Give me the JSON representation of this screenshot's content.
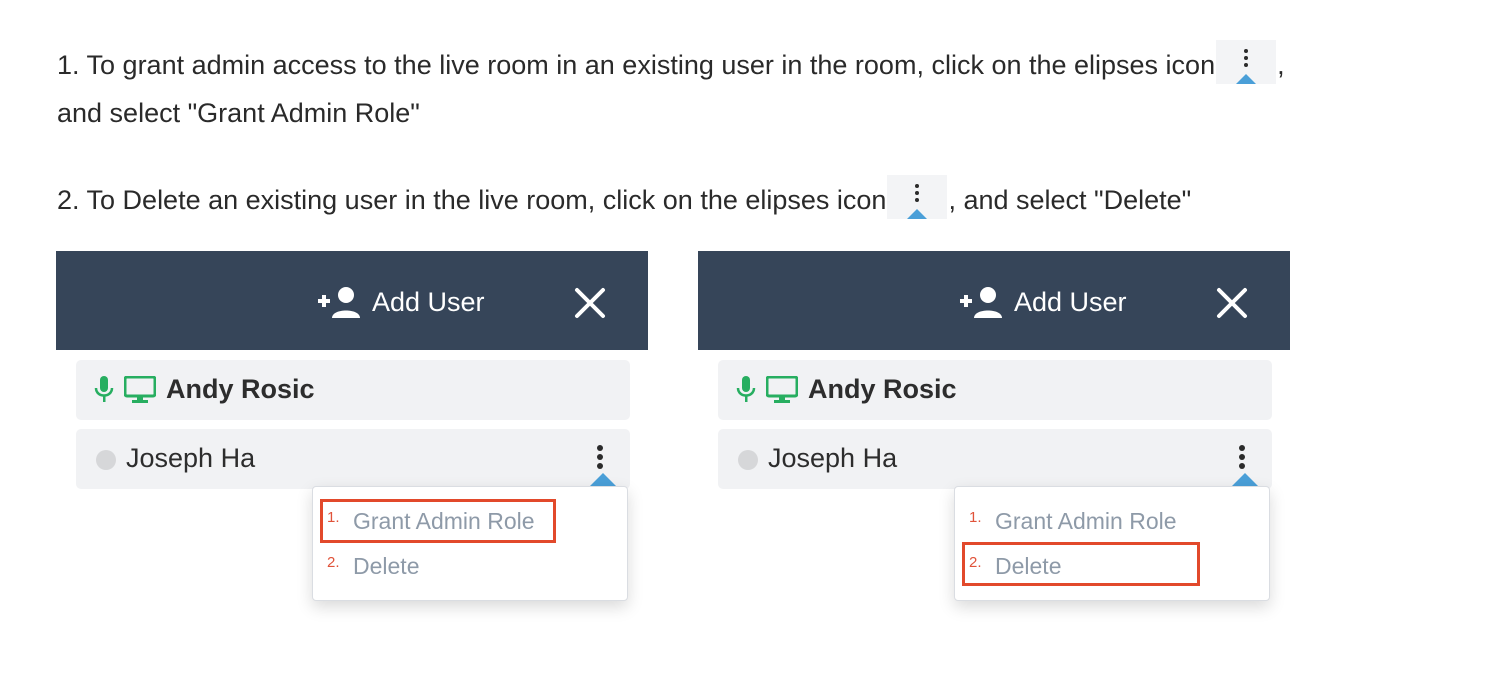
{
  "instructions": {
    "step1": {
      "before_icon": "1. To grant admin access to the live room in an existing user in the room, click on the elipses icon",
      "after_icon": ",",
      "line2": "and select \"Grant Admin Role\""
    },
    "step2": {
      "before_icon": "2. To Delete an existing user in the live room, click on the elipses icon",
      "after_icon": ", and select \"Delete\""
    },
    "icon": "vertical-ellipsis-icon"
  },
  "panels": [
    {
      "header": {
        "add_user_label": "Add User",
        "add_user_icon": "add-user-icon",
        "close_icon": "close-icon"
      },
      "users": [
        {
          "name": "Andy Rosic",
          "icons": [
            "microphone-icon",
            "monitor-icon"
          ],
          "color": "#27ae60"
        },
        {
          "name": "Joseph Ha",
          "status": "offline"
        }
      ],
      "menu": [
        {
          "num": "1.",
          "label": "Grant Admin Role"
        },
        {
          "num": "2.",
          "label": "Delete"
        }
      ],
      "highlighted_item": 1
    },
    {
      "header": {
        "add_user_label": "Add User",
        "add_user_icon": "add-user-icon",
        "close_icon": "close-icon"
      },
      "users": [
        {
          "name": "Andy Rosic",
          "icons": [
            "microphone-icon",
            "monitor-icon"
          ],
          "color": "#27ae60"
        },
        {
          "name": "Joseph Ha",
          "status": "offline"
        }
      ],
      "menu": [
        {
          "num": "1.",
          "label": "Grant Admin Role"
        },
        {
          "num": "2.",
          "label": "Delete"
        }
      ],
      "highlighted_item": 2
    }
  ],
  "colors": {
    "header_bg": "#364559",
    "accent": "#4a9fd8",
    "highlight": "#e2492b",
    "status_green": "#27ae60"
  }
}
